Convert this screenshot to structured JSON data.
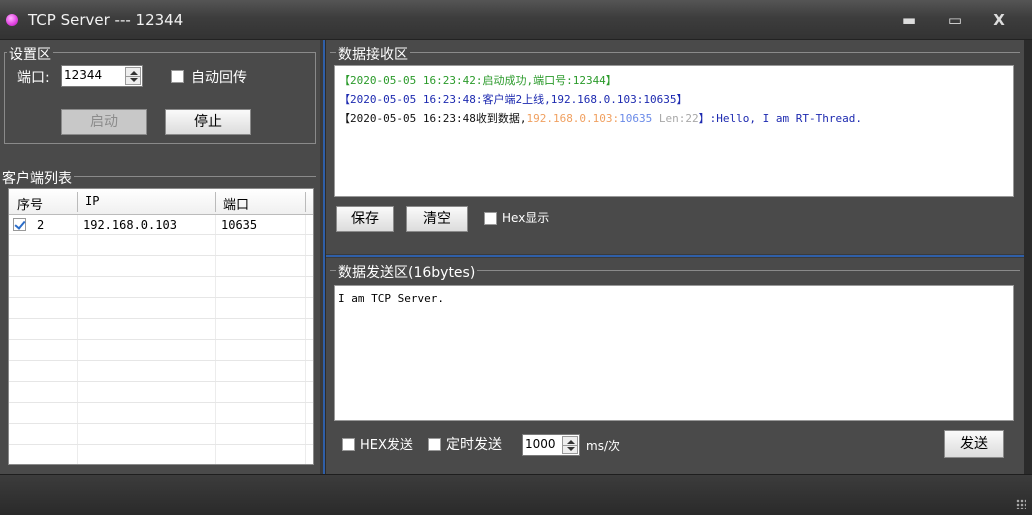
{
  "window": {
    "title": "TCP Server --- 12344",
    "minimize_glyph": "▬",
    "maximize_glyph": "▭",
    "close_glyph": "X"
  },
  "settings": {
    "group_title": "设置区",
    "port_label": "端口:",
    "port_value": "12344",
    "auto_echo_label": "自动回传",
    "auto_echo_checked": false,
    "start_label": "启动",
    "stop_label": "停止"
  },
  "clients": {
    "group_title": "客户端列表",
    "columns": [
      "序号",
      "IP",
      "端口"
    ],
    "rows": [
      {
        "checked": true,
        "index": "2",
        "ip": "192.168.0.103",
        "port": "10635"
      }
    ]
  },
  "receive": {
    "group_title": "数据接收区",
    "lines": [
      {
        "parts": [
          {
            "text": "【2020-05-05 16:23:42:启动成功,端口号:12344】",
            "color": "green"
          }
        ]
      },
      {
        "parts": [
          {
            "text": "【2020-05-05 16:23:48:客户端2上线,192.168.0.103:10635】",
            "color": "navy"
          }
        ]
      },
      {
        "parts": [
          {
            "text": "【2020-05-05 16:23:48收到数据,",
            "color": "blk"
          },
          {
            "text": "192.168.0.103:",
            "color": "orange"
          },
          {
            "text": "10635 ",
            "color": "lblue"
          },
          {
            "text": "Len:22",
            "color": "gray"
          },
          {
            "text": "】:Hello, I am RT-Thread.",
            "color": "navy"
          }
        ]
      }
    ],
    "save_label": "保存",
    "clear_label": "清空",
    "hex_display_label": "Hex显示",
    "hex_display_checked": false
  },
  "send": {
    "group_title": "数据发送区(16bytes)",
    "content": "I am TCP Server.",
    "hex_send_label": "HEX发送",
    "hex_send_checked": false,
    "timed_send_label": "定时发送",
    "timed_send_checked": false,
    "interval_value": "1000",
    "interval_unit": "ms/次",
    "send_label": "发送"
  },
  "colors": {
    "accent": "#2f5fa8",
    "panel": "#4a4a4a",
    "green": "#2a9a2a",
    "navy": "#1d2ab0"
  }
}
